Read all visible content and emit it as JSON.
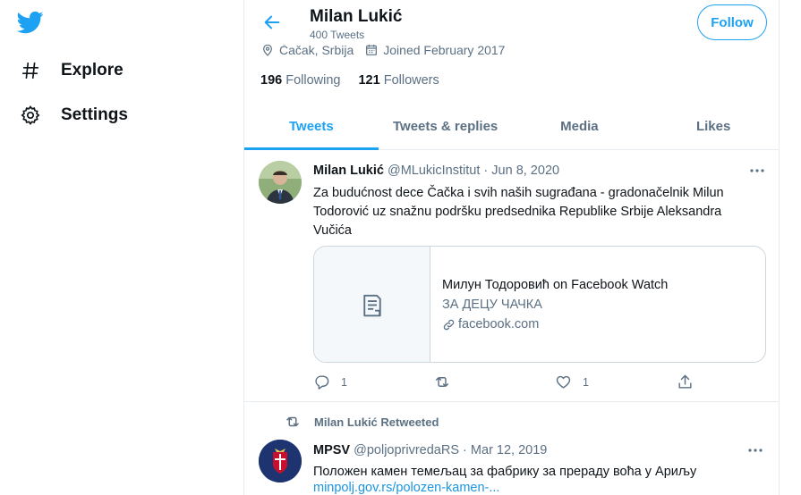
{
  "nav": {
    "logo": "twitter-bird-icon",
    "items": [
      {
        "label": "Explore",
        "icon": "hashtag-icon"
      },
      {
        "label": "Settings",
        "icon": "gear-icon"
      }
    ]
  },
  "header": {
    "name": "Milan Lukić",
    "tweet_count": "400 Tweets",
    "follow_label": "Follow"
  },
  "profile": {
    "location": "Čačak, Srbija",
    "joined": "Joined February 2017",
    "following_count": "196",
    "following_label": "Following",
    "followers_count": "121",
    "followers_label": "Followers"
  },
  "tabs": [
    {
      "label": "Tweets",
      "active": true
    },
    {
      "label": "Tweets & replies",
      "active": false
    },
    {
      "label": "Media",
      "active": false
    },
    {
      "label": "Likes",
      "active": false
    }
  ],
  "tweets": [
    {
      "name": "Milan Lukić",
      "handle": "@MLukicInstitut",
      "sep": "·",
      "date": "Jun 8, 2020",
      "text": "Za budućnost dece Čačka i svih naših sugrađana - gradonačelnik Milun Todorović uz snažnu podršku predsednika Republike Srbije Aleksandra Vučića",
      "card": {
        "title": "Милун Тодоровић on Facebook Watch",
        "description": "ЗА ДЕЦУ ЧАЧКА",
        "domain": "facebook.com"
      },
      "replies": "1",
      "likes": "1"
    },
    {
      "retweeted_by": "Milan Lukić Retweeted",
      "name": "MPSV",
      "handle": "@poljoprivredaRS",
      "sep": "·",
      "date": "Mar 12, 2019",
      "text": "Положен камен темељац за фабрику за прераду воћа у Ариљу",
      "link": "minpolj.gov.rs/polozen-kamen-..."
    }
  ],
  "colors": {
    "accent": "#1da1f2",
    "text": "#0f1419",
    "secondary": "#5b7083",
    "border": "#e6ecf0"
  }
}
